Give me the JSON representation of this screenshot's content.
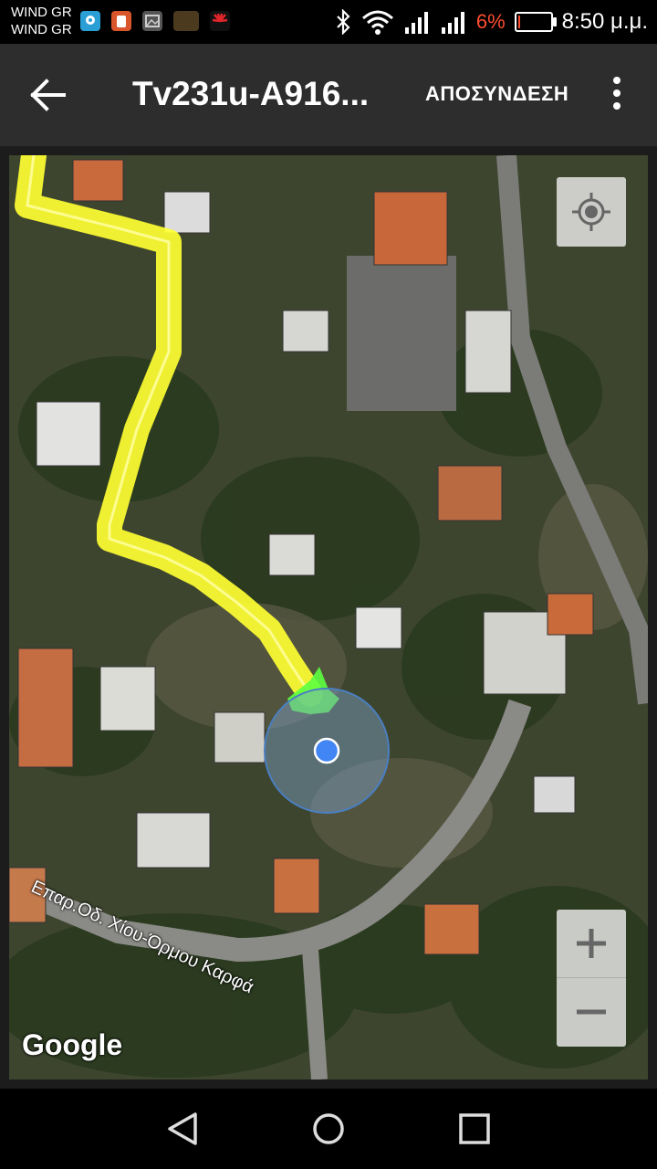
{
  "status_bar": {
    "carrier_1": "WIND GR",
    "carrier_2": "WIND GR",
    "battery_percent": "6%",
    "time": "8:50 μ.μ.",
    "notification_icons": [
      "maps-pin-icon",
      "app-icon",
      "gallery-icon",
      "video-thumb-icon",
      "huawei-icon"
    ],
    "status_icons": [
      "bluetooth-icon",
      "wifi-icon",
      "signal-icon",
      "signal-icon",
      "battery-icon"
    ],
    "battery_level": 0.06,
    "battery_color": "#ff4d2e"
  },
  "app_bar": {
    "title": "Tv231u-A916...",
    "disconnect_label": "ΑΠΟΣΥΝΔΕΣΗ",
    "back_icon": "arrow-left-icon",
    "menu_icon": "more-vert-icon",
    "background": "#2d2d2d"
  },
  "map": {
    "type": "satellite",
    "road_label": "Επαρ.Οδ. Χίου-Όρμου Καρφά",
    "attribution": "Google",
    "track_color": "#ffff33",
    "location_dot_color": "#4285f4",
    "controls": {
      "locate_icon": "my-location-icon",
      "zoom_in_label": "+",
      "zoom_out_label": "−"
    }
  },
  "nav_bar": {
    "buttons": [
      "back-triangle-icon",
      "home-circle-icon",
      "recents-square-icon"
    ]
  }
}
